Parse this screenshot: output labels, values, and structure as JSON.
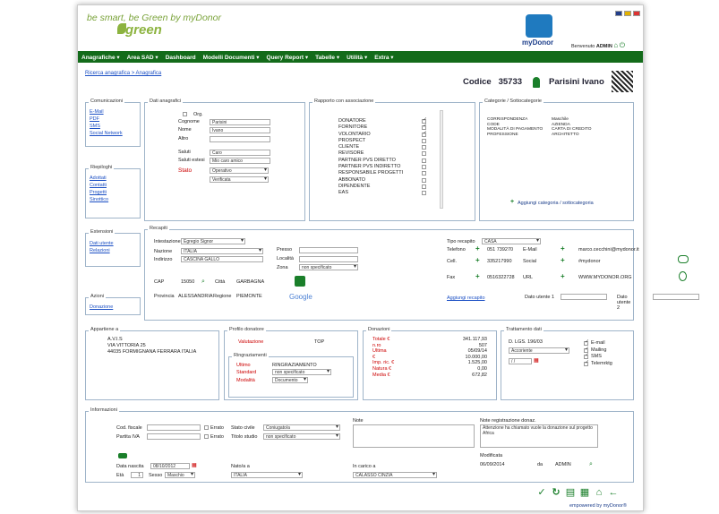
{
  "header": {
    "logo_line1": "be smart, be Green by myDonor",
    "logo_line2": "green",
    "brand": "myDonor",
    "welcome": "Benvenuto",
    "user": "ADMIN"
  },
  "menu": [
    "Anagrafiche ▾",
    "Area SAD ▾",
    "Dashboard",
    "Modelli Documenti ▾",
    "Query Report ▾",
    "Tabelle ▾",
    "Utilità ▾",
    "Extra ▾"
  ],
  "breadcrumb": {
    "a": "Ricerca anagrafica",
    "sep": " > ",
    "b": "Anagrafica"
  },
  "record": {
    "codice_label": "Codice",
    "codice": "35733",
    "name": "Parisini Ivano"
  },
  "comunicazioni": {
    "title": "Comunicazioni",
    "links": [
      "E-Mail",
      "PDF",
      "SMS",
      "Social Network"
    ]
  },
  "riepiloghi": {
    "title": "Riepiloghi",
    "links": [
      "Adottati",
      "Contatti",
      "Progetti",
      "Sinottico"
    ]
  },
  "estensioni": {
    "title": "Estensioni",
    "links": [
      "Dati utente",
      "Relazioni"
    ]
  },
  "azioni": {
    "title": "Azioni",
    "links": [
      "Donazione"
    ]
  },
  "dati": {
    "title": "Dati anagrafici",
    "org": "Org.",
    "cognome_l": "Cognome",
    "cognome": "Parisini",
    "nome_l": "Nome",
    "nome": "Ivano",
    "altro_l": "Altro",
    "saluti_l": "Saluti",
    "saluti": "Caro",
    "salest_l": "Saluti estesi",
    "salest": "Mio caro amico",
    "stato_l": "Stato",
    "stato": "Operativo",
    "verif": "Verificata"
  },
  "rapporto": {
    "title": "Rapporto con associazione",
    "items": [
      "DONATORE",
      "FORNITORE",
      "VOLONTARIO",
      "PROSPECT",
      "CLIENTE",
      "REVISORE",
      "PARTNER PVS DIRETTO",
      "PARTNER PVS INDIRETTO",
      "RESPONSABILE PROGETTI",
      "ABBONATO",
      "DIPENDENTE",
      "EAS"
    ]
  },
  "categorie": {
    "title": "Categorie / Sottocategorie",
    "rows": [
      [
        "CORRISPONDENZA",
        "Maschile"
      ],
      [
        "CODE",
        "AZIENDA"
      ],
      [
        "MODALITÀ DI PAGAMENTO",
        "CARTA DI CREDITO"
      ],
      [
        "PROFESSIONE",
        "ARCHITETTO"
      ]
    ],
    "add": "Aggiungi categoria / sottocategoria"
  },
  "recapiti": {
    "title": "Recapiti",
    "intest_l": "Intestazione",
    "intest": "Egregio Signor",
    "nazione_l": "Nazione",
    "nazione": "ITALIA",
    "indirizzo_l": "Indirizzo",
    "indirizzo": "CASCINA GALLO",
    "presso_l": "Presso",
    "localita_l": "Località",
    "zona_l": "Zona",
    "zona": "non specificato",
    "cap_l": "CAP",
    "cap": "15050",
    "citta_l": "Città",
    "citta": "GARBAGNA",
    "prov_l": "Provincia",
    "prov": "ALESSANDRIA",
    "regione_l": "Regione",
    "regione": "PIEMONTE",
    "maps": "Google",
    "tipo_l": "Tipo recapito",
    "tipo": "CASA",
    "tel_l": "Telefono",
    "tel": "051 739270",
    "cell_l": "Cell.",
    "cell": "335217990",
    "fax_l": "Fax",
    "fax": "0516322728",
    "email_l": "E-Mail",
    "email": "marco.cecchini@mydonor.it",
    "social_l": "Social",
    "social": "#mydonor",
    "url_l": "URL",
    "url": "WWW.MYDONOR.ORG",
    "agg": "Aggiungi recapito",
    "du1": "Dato utente 1",
    "du2": "Dato utente 2"
  },
  "appartiene": {
    "title": "Appartiene a",
    "l1": "A.V.I.S",
    "l2": "VIA VITTORIA 25",
    "l3": "44035 FORMIGNANA FERRARA ITALIA"
  },
  "profilo": {
    "title": "Profilo donatore",
    "val_l": "Valutazione",
    "val": "TOP"
  },
  "ringr": {
    "title": "Ringraziamenti",
    "ultimo_l": "Ultimo",
    "ultimo": "RINGRAZIAMENTO",
    "std_l": "Standard",
    "std": "non specificato",
    "mod_l": "Modalità",
    "mod": "Documento"
  },
  "donazioni": {
    "title": "Donazioni",
    "rows": [
      [
        "Totale €",
        "341.117,93"
      ],
      [
        "n.ro",
        "507"
      ],
      [
        "Ultima",
        "05/09/14"
      ],
      [
        "€",
        "10.000,00"
      ],
      [
        "Imp. ric. €",
        "1.525,00"
      ],
      [
        "Natura €",
        "0,00"
      ],
      [
        "Media €",
        "672,82"
      ]
    ]
  },
  "trattamento": {
    "title": "Trattamento dati",
    "dlgs": "D. LGS. 196/03",
    "acc": "Accoriente",
    "opts": [
      "E-mail",
      "Mailing",
      "SMS",
      "Telemrktg"
    ]
  },
  "info": {
    "title": "Informazioni",
    "cf_l": "Cod. fiscale",
    "errato": "Errato",
    "piva_l": "Partita IVA",
    "sc_l": "Stato civile",
    "sc": "Coniugato/a",
    "ts_l": "Titolo studio",
    "ts": "non specificato",
    "note_l": "Note",
    "nr_l": "Note registrazione donaz.",
    "nr": "Attenzione ha chiamato vuole la donazione sul progetto Africa",
    "mod_l": "Modificata",
    "mod": "06/09/2014",
    "da_l": "da",
    "da": "ADMIN",
    "nasc_l": "Data nascita",
    "nasc": "08/10/2012",
    "eta_l": "Età",
    "eta": "1",
    "sesso_l": "Sesso",
    "sesso": "Maschio",
    "nato_l": "Nato/a a",
    "nato": "ITALIA",
    "carico_l": "In carico a",
    "carico": "CALASSO CINZIA"
  },
  "footer": "empowered by myDonor®"
}
